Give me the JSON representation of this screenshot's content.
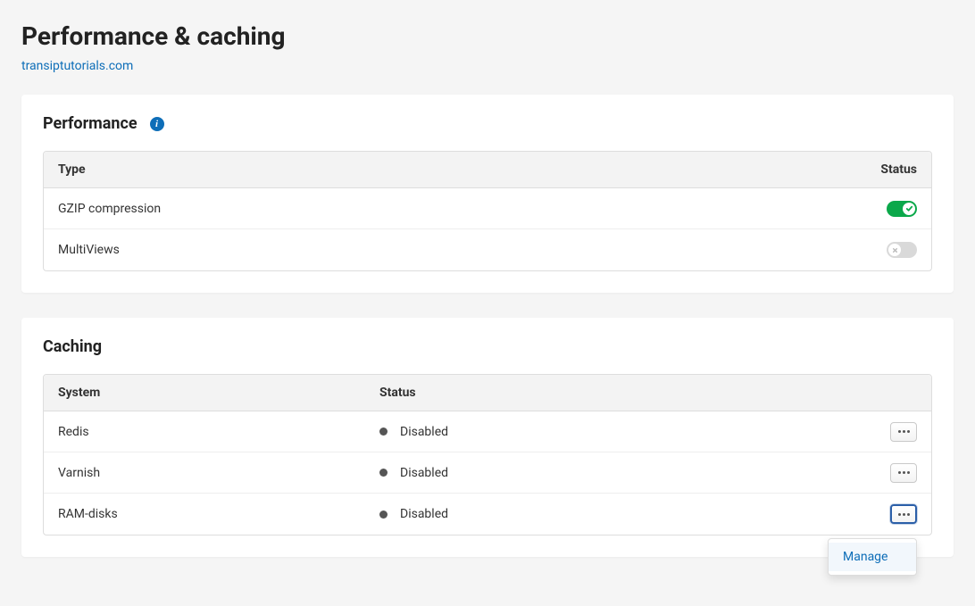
{
  "page": {
    "title": "Performance & caching",
    "domain_link": "transiptutorials.com"
  },
  "performance": {
    "title": "Performance",
    "columns": {
      "type": "Type",
      "status": "Status"
    },
    "rows": [
      {
        "label": "GZIP compression",
        "enabled": true
      },
      {
        "label": "MultiViews",
        "enabled": false
      }
    ]
  },
  "caching": {
    "title": "Caching",
    "columns": {
      "system": "System",
      "status": "Status"
    },
    "rows": [
      {
        "system": "Redis",
        "status": "Disabled"
      },
      {
        "system": "Varnish",
        "status": "Disabled"
      },
      {
        "system": "RAM-disks",
        "status": "Disabled"
      }
    ],
    "dropdown": {
      "manage": "Manage"
    }
  }
}
